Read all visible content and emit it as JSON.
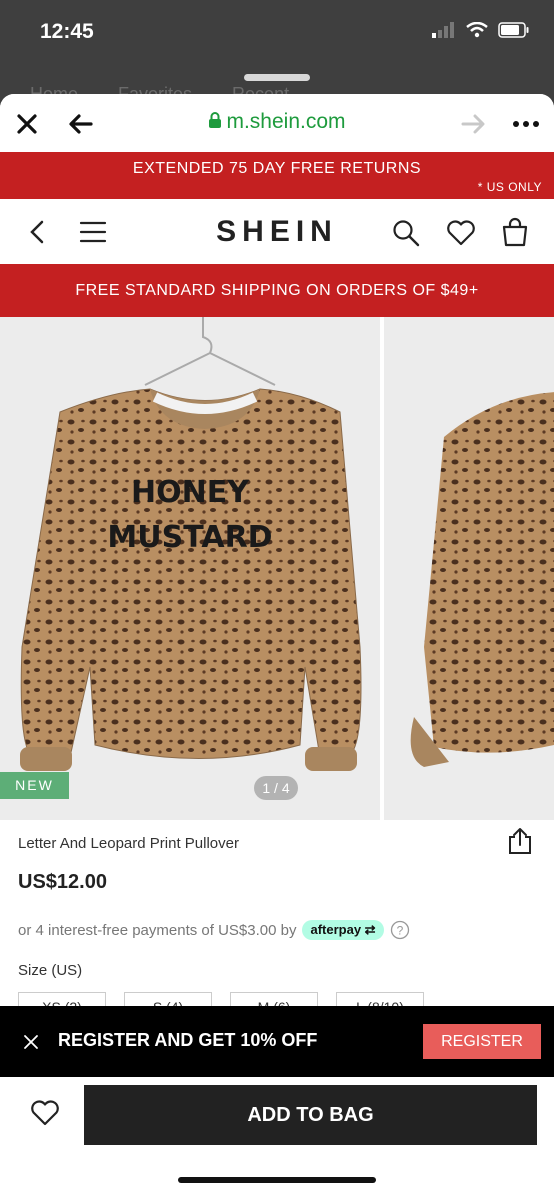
{
  "status_bar": {
    "time": "12:45"
  },
  "background_tabs": [
    "Home",
    "Favorites",
    "Recent"
  ],
  "browser": {
    "url": "m.shein.com"
  },
  "promo_top": {
    "main": "EXTENDED 75 DAY FREE RETURNS",
    "sub": "* US ONLY"
  },
  "header": {
    "logo": "SHEIN"
  },
  "promo_shipping": {
    "text": "FREE STANDARD SHIPPING ON ORDERS OF $49+"
  },
  "gallery": {
    "badge": "NEW",
    "pager": "1 / 4",
    "print_text": [
      "HONEY",
      "MUSTARD"
    ]
  },
  "product": {
    "title": "Letter And Leopard Print Pullover",
    "price": "US$12.00",
    "installments": "or 4 interest-free payments of US$3.00 by",
    "afterpay": "afterpay",
    "size_label": "Size (US)",
    "sizes": [
      "XS (2)",
      "S (4)",
      "M (6)",
      "L (8/10)"
    ]
  },
  "register_banner": {
    "text": "REGISTER AND GET 10% OFF",
    "button": "REGISTER"
  },
  "bottom": {
    "add_to_bag": "ADD TO BAG"
  },
  "colors": {
    "brand_red": "#c42021",
    "url_green": "#1e9b3d",
    "new_green": "#5dae77",
    "register_red": "#e85d5a"
  }
}
